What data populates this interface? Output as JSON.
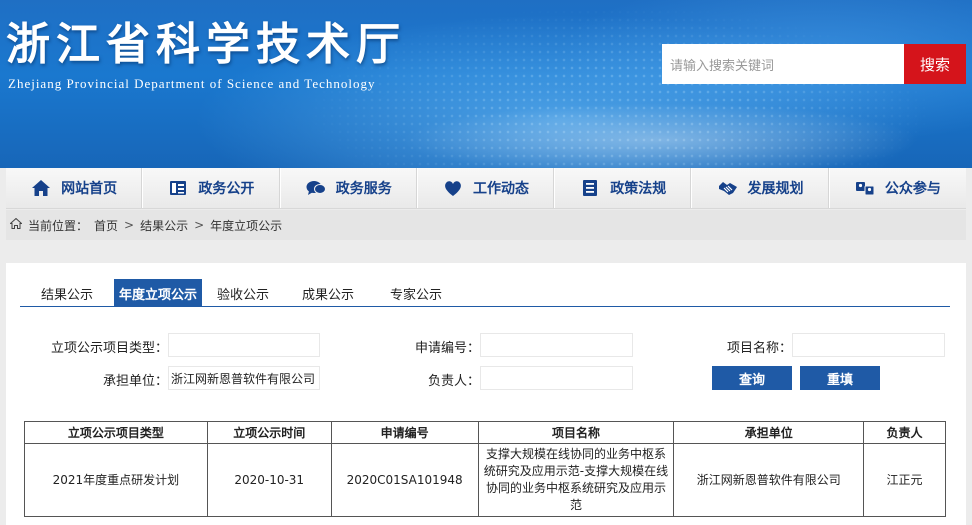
{
  "header": {
    "title": "浙江省科学技术厅",
    "subtitle": "Zhejiang Provincial Department of Science and Technology",
    "search_placeholder": "请输入搜索关键词",
    "search_button": "搜索"
  },
  "nav": {
    "items": [
      {
        "label": "网站首页",
        "icon": "home-icon"
      },
      {
        "label": "政务公开",
        "icon": "document-icon"
      },
      {
        "label": "政务服务",
        "icon": "chat-icon"
      },
      {
        "label": "工作动态",
        "icon": "heart-icon"
      },
      {
        "label": "政策法规",
        "icon": "list-icon"
      },
      {
        "label": "发展规划",
        "icon": "handshake-icon"
      },
      {
        "label": "公众参与",
        "icon": "people-icon"
      }
    ]
  },
  "breadcrumb": {
    "prefix": "当前位置：",
    "items": [
      "首页",
      "结果公示",
      "年度立项公示"
    ],
    "sep": ">"
  },
  "tabs": [
    {
      "label": "结果公示",
      "active": false
    },
    {
      "label": "年度立项公示",
      "active": true
    },
    {
      "label": "验收公示",
      "active": false
    },
    {
      "label": "成果公示",
      "active": false
    },
    {
      "label": "专家公示",
      "active": false
    }
  ],
  "form": {
    "type_label": "立项公示项目类型：",
    "type_value": "",
    "appno_label": "申请编号：",
    "appno_value": "",
    "name_label": "项目名称：",
    "name_value": "",
    "unit_label": "承担单位：",
    "unit_value": "浙江网新恩普软件有限公司",
    "owner_label": "负责人：",
    "owner_value": "",
    "query_button": "查询",
    "reset_button": "重填"
  },
  "table": {
    "headers": [
      "立项公示项目类型",
      "立项公示时间",
      "申请编号",
      "项目名称",
      "承担单位",
      "负责人"
    ],
    "rows": [
      [
        "2021年度重点研发计划",
        "2020-10-31",
        "2020C01SA101948",
        "支撑大规模在线协同的业务中枢系统研究及应用示范-支撑大规模在线协同的业务中枢系统研究及应用示范",
        "浙江网新恩普软件有限公司",
        "江正元"
      ]
    ]
  },
  "colors": {
    "accent": "#1f5aa6",
    "nav_text": "#16418a",
    "search_button": "#d5141b"
  }
}
